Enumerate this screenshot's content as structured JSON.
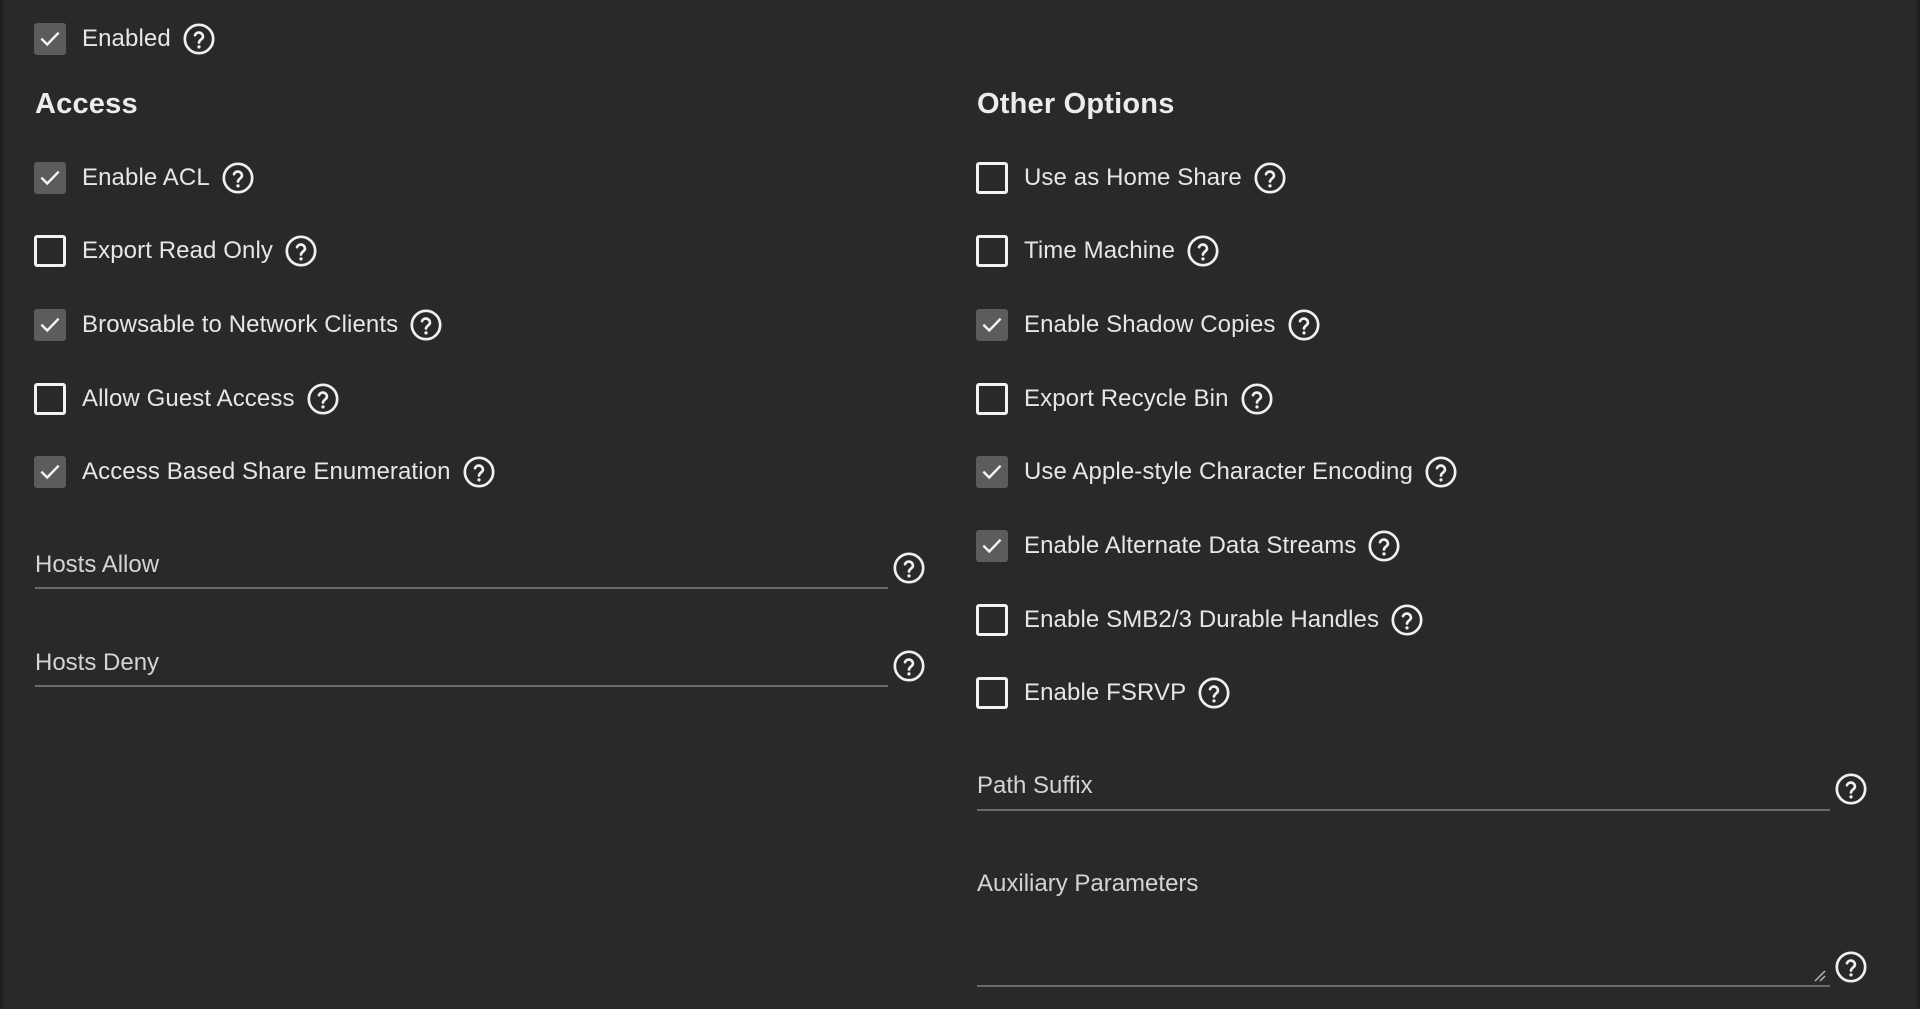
{
  "enabled": {
    "label": "Enabled",
    "checked": true
  },
  "access": {
    "title": "Access",
    "options": [
      {
        "label": "Enable ACL",
        "checked": true
      },
      {
        "label": "Export Read Only",
        "checked": false
      },
      {
        "label": "Browsable to Network Clients",
        "checked": true
      },
      {
        "label": "Allow Guest Access",
        "checked": false
      },
      {
        "label": "Access Based Share Enumeration",
        "checked": true
      }
    ],
    "hosts_allow": {
      "label": "Hosts Allow",
      "value": ""
    },
    "hosts_deny": {
      "label": "Hosts Deny",
      "value": ""
    }
  },
  "other": {
    "title": "Other Options",
    "options": [
      {
        "label": "Use as Home Share",
        "checked": false
      },
      {
        "label": "Time Machine",
        "checked": false
      },
      {
        "label": "Enable Shadow Copies",
        "checked": true
      },
      {
        "label": "Export Recycle Bin",
        "checked": false
      },
      {
        "label": "Use Apple-style Character Encoding",
        "checked": true
      },
      {
        "label": "Enable Alternate Data Streams",
        "checked": true
      },
      {
        "label": "Enable SMB2/3 Durable Handles",
        "checked": false
      },
      {
        "label": "Enable FSRVP",
        "checked": false
      }
    ],
    "path_suffix": {
      "label": "Path Suffix",
      "value": ""
    },
    "aux_params": {
      "label": "Auxiliary Parameters",
      "value": ""
    }
  },
  "icons": {
    "help": "question-circle-icon",
    "check": "checkmark-icon",
    "resize": "resize-grip-icon"
  },
  "colors": {
    "background": "#292929",
    "checked_box": "#5c5c5c",
    "text": "#e6e6e6",
    "underline": "#6a6a6a"
  }
}
